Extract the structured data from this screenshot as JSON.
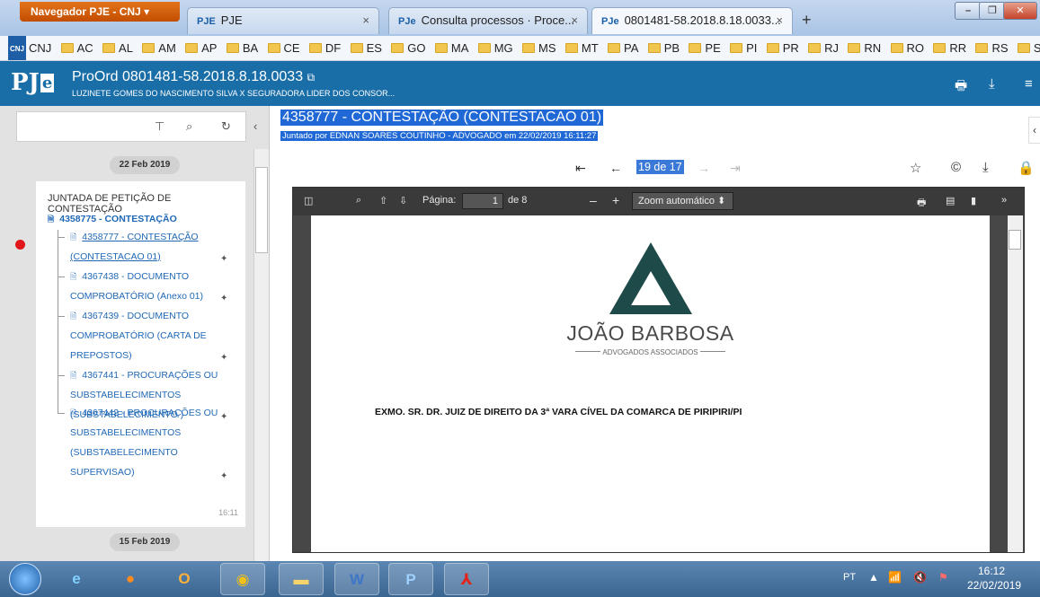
{
  "browser": {
    "nav_button": "Navegador PJE - CNJ",
    "tabs": [
      {
        "fav": "PJE",
        "label": "PJE"
      },
      {
        "fav": "PJe",
        "label": "Consulta processos · Proce..."
      },
      {
        "fav": "PJe",
        "label": "0801481-58.2018.8.18.0033..."
      }
    ],
    "bookmarks": [
      "CNJ",
      "AC",
      "AL",
      "AM",
      "AP",
      "BA",
      "CE",
      "DF",
      "ES",
      "GO",
      "MA",
      "MG",
      "MS",
      "MT",
      "PA",
      "PB",
      "PE",
      "PI",
      "PR",
      "RJ",
      "RN",
      "RO",
      "RR",
      "RS",
      "SC"
    ],
    "cnj_badge": "CNJ"
  },
  "header": {
    "logo_main": "PJ",
    "logo_e": "e",
    "case_title": "ProOrd 0801481-58.2018.8.18.0033",
    "parties": "LUZINETE GOMES DO NASCIMENTO SILVA X SEGURADORA LIDER DOS CONSOR..."
  },
  "timeline": {
    "date_top": "22 Feb 2019",
    "date_bottom": "15 Feb 2019",
    "event_title": "JUNTADA DE PETIÇÃO DE CONTESTAÇÃO",
    "main_doc": "4358775 - CONTESTAÇÃO",
    "attachments": [
      {
        "l1": "4358777 - CONTESTAÇÃO",
        "l2": "(CONTESTACAO 01)"
      },
      {
        "l1": "4367438 - DOCUMENTO",
        "l2": "COMPROBATÓRIO (Anexo 01)"
      },
      {
        "l1": "4367439 - DOCUMENTO",
        "l2": "COMPROBATÓRIO (CARTA DE",
        "l3": "PREPOSTOS)"
      },
      {
        "l1": "4367441 - PROCURAÇÕES OU",
        "l2": "SUBSTABELECIMENTOS",
        "l3": "(SUBSTABELECIMENTO )"
      },
      {
        "l1": "4367442 - PROCURAÇÕES OU",
        "l2": "SUBSTABELECIMENTOS",
        "l3": "(SUBSTABELECIMENTO",
        "l4": "SUPERVISAO)"
      }
    ],
    "time": "16:11"
  },
  "document": {
    "title": "4358777 - CONTESTAÇÃO (CONTESTACAO 01)",
    "subtitle": "Juntado por EDNAN SOARES COUTINHO - ADVOGADO em 22/02/2019 16:11:27",
    "page_count": "19 de 17"
  },
  "viewer": {
    "page_label": "Página:",
    "page_value": "1",
    "page_total": "de 8",
    "zoom": "Zoom automático",
    "logo_name": "JOÃO BARBOSA",
    "logo_sub": "ADVOGADOS ASSOCIADOS",
    "body_text": "EXMO. SR. DR. JUIZ DE DIREITO DA 3ª VARA CÍVEL DA COMARCA DE PIRIPIRI/PI"
  },
  "taskbar": {
    "lang": "PT",
    "time": "16:12",
    "date": "22/02/2019",
    "apps": [
      "ie",
      "firefox",
      "outlook",
      "chrome",
      "explorer",
      "word",
      "pje",
      "acrobat"
    ]
  },
  "colors": {
    "app_header": "#1a6ea8",
    "link": "#1f68b6",
    "selection": "#1f68d6",
    "event_dot": "#e0161b",
    "logo": "#1f4a4a"
  }
}
